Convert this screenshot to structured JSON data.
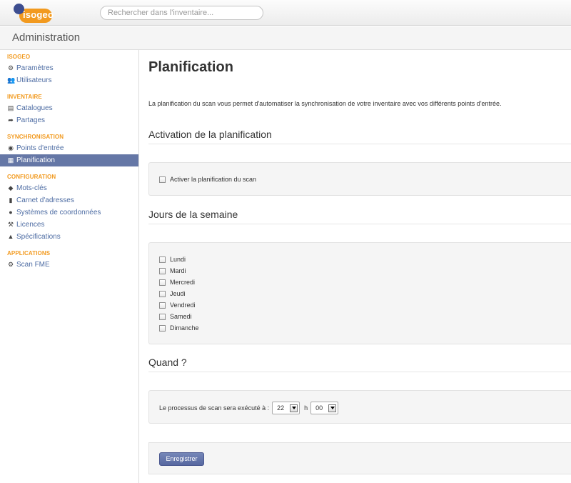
{
  "app": {
    "logo_text": "isogeo"
  },
  "search": {
    "placeholder": "Rechercher dans l'inventaire..."
  },
  "subheader": {
    "title": "Administration"
  },
  "sidebar": {
    "sections": [
      {
        "title": "ISOGEO",
        "items": [
          {
            "label": "Paramètres",
            "icon": "cogs-icon"
          },
          {
            "label": "Utilisateurs",
            "icon": "users-icon"
          }
        ]
      },
      {
        "title": "INVENTAIRE",
        "items": [
          {
            "label": "Catalogues",
            "icon": "catalog-icon"
          },
          {
            "label": "Partages",
            "icon": "share-icon"
          }
        ]
      },
      {
        "title": "SYNCHRONISATION",
        "items": [
          {
            "label": "Points d'entrée",
            "icon": "eye-icon"
          },
          {
            "label": "Planification",
            "icon": "calendar-icon",
            "active": true
          }
        ]
      },
      {
        "title": "CONFIGURATION",
        "items": [
          {
            "label": "Mots-clés",
            "icon": "tags-icon"
          },
          {
            "label": "Carnet d'adresses",
            "icon": "address-book-icon"
          },
          {
            "label": "Systèmes de coordonnées",
            "icon": "globe-icon"
          },
          {
            "label": "Licences",
            "icon": "gavel-icon"
          },
          {
            "label": "Spécifications",
            "icon": "flask-icon"
          }
        ]
      },
      {
        "title": "APPLICATIONS",
        "items": [
          {
            "label": "Scan FME",
            "icon": "cog-icon"
          }
        ]
      }
    ]
  },
  "main": {
    "title": "Planification",
    "intro": "La planification du scan vous permet d'automatiser la synchronisation de votre inventaire avec vos différents points d'entrée.",
    "activation": {
      "heading": "Activation de la planification",
      "checkbox_label": "Activer la planification du scan",
      "checked": false
    },
    "days": {
      "heading": "Jours de la semaine",
      "items": [
        "Lundi",
        "Mardi",
        "Mercredi",
        "Jeudi",
        "Vendredi",
        "Samedi",
        "Dimanche"
      ]
    },
    "when": {
      "heading": "Quand ?",
      "label": "Le processus de scan sera exécuté à :",
      "hour": "22",
      "hour_sep": "h",
      "minute": "00"
    },
    "save_label": "Enregistrer"
  },
  "colors": {
    "accent_orange": "#f29a1f",
    "nav_active": "#6577a6",
    "link_blue": "#4d6ca3",
    "button_blue": "#5f70a8"
  }
}
